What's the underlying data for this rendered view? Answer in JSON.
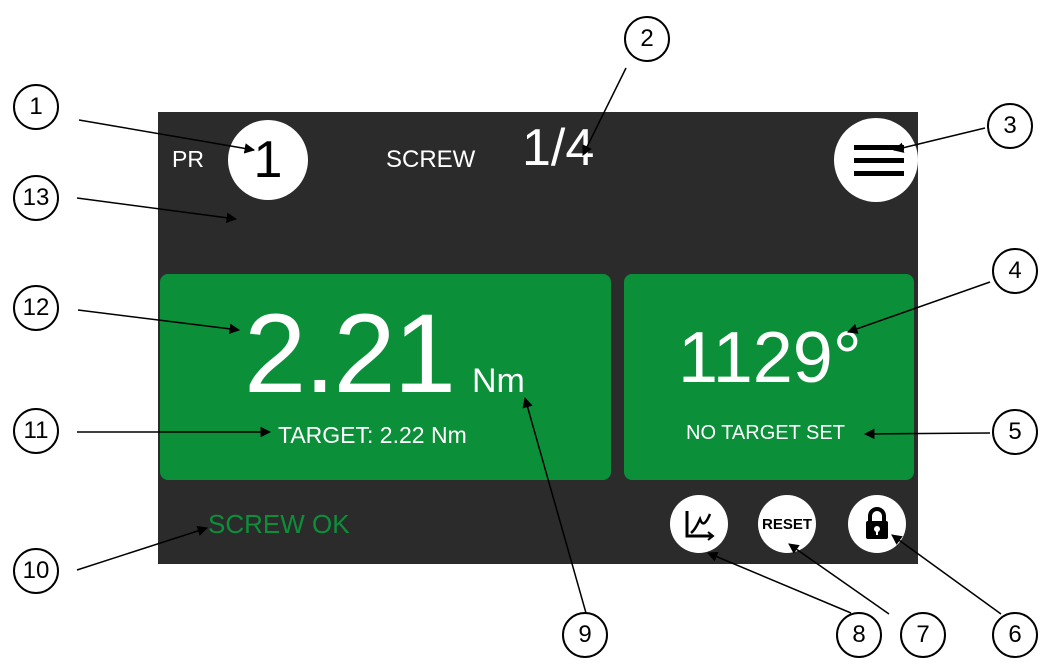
{
  "screen": {
    "program_label": "PR",
    "program_number": "1",
    "screw_label": "SCREW",
    "screw_count": "1/4",
    "menu_icon": "hamburger-menu-icon",
    "torque": {
      "value": "2.21",
      "unit": "Nm",
      "target_text": "TARGET: 2.22 Nm"
    },
    "angle": {
      "value": "1129°",
      "target_text": "NO TARGET SET"
    },
    "status_text": "SCREW OK",
    "buttons": {
      "graph_icon": "graph-icon",
      "reset_label": "RESET",
      "lock_icon": "lock-icon"
    }
  },
  "callouts": [
    "1",
    "2",
    "3",
    "4",
    "5",
    "6",
    "7",
    "8",
    "9",
    "10",
    "11",
    "12",
    "13"
  ],
  "colors": {
    "screen_bg": "#2b2b2b",
    "panel_green": "#0c8f39",
    "status_green": "#0c8f39",
    "text_white": "#ffffff"
  }
}
